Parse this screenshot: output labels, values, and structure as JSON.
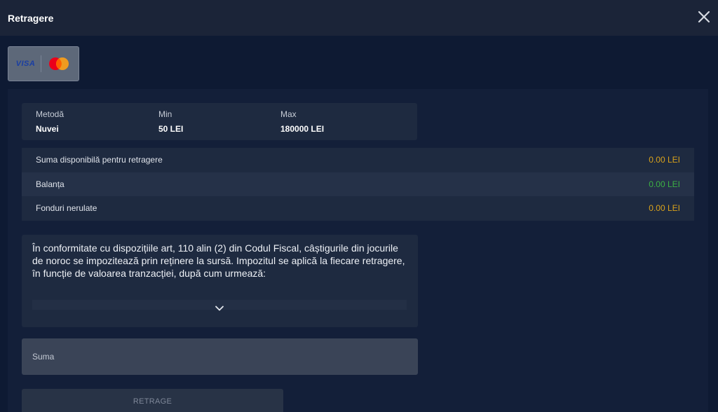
{
  "header": {
    "title": "Retragere",
    "close_icon": "close-icon"
  },
  "payment_method": {
    "visa_label": "VISA",
    "icons": [
      "visa-logo-icon",
      "mastercard-logo-icon"
    ]
  },
  "info": {
    "method_label": "Metodă",
    "method_value": "Nuvei",
    "min_label": "Min",
    "min_value": "50 LEI",
    "max_label": "Max",
    "max_value": "180000 LEI"
  },
  "balances": [
    {
      "label": "Suma disponibilă pentru retragere",
      "value": "0.00 LEI",
      "color": "#d9a21b"
    },
    {
      "label": "Balanța",
      "value": "0.00 LEI",
      "color": "#3cb043"
    },
    {
      "label": "Fonduri nerulate",
      "value": "0.00 LEI",
      "color": "#d9a21b"
    }
  ],
  "tax_notice": {
    "text": "În conformitate cu dispozițiile art, 110 alin (2) din Codul Fiscal, câștigurile din jocurile de noroc se impozitează prin reținere la sursă. Impozitul se aplică la fiecare retragere, în funcție de valoarea tranzacției, după cum urmează:",
    "expand_icon": "chevron-down-icon"
  },
  "amount_input": {
    "placeholder": "Suma",
    "value": ""
  },
  "withdraw_button": {
    "label": "RETRAGE"
  }
}
